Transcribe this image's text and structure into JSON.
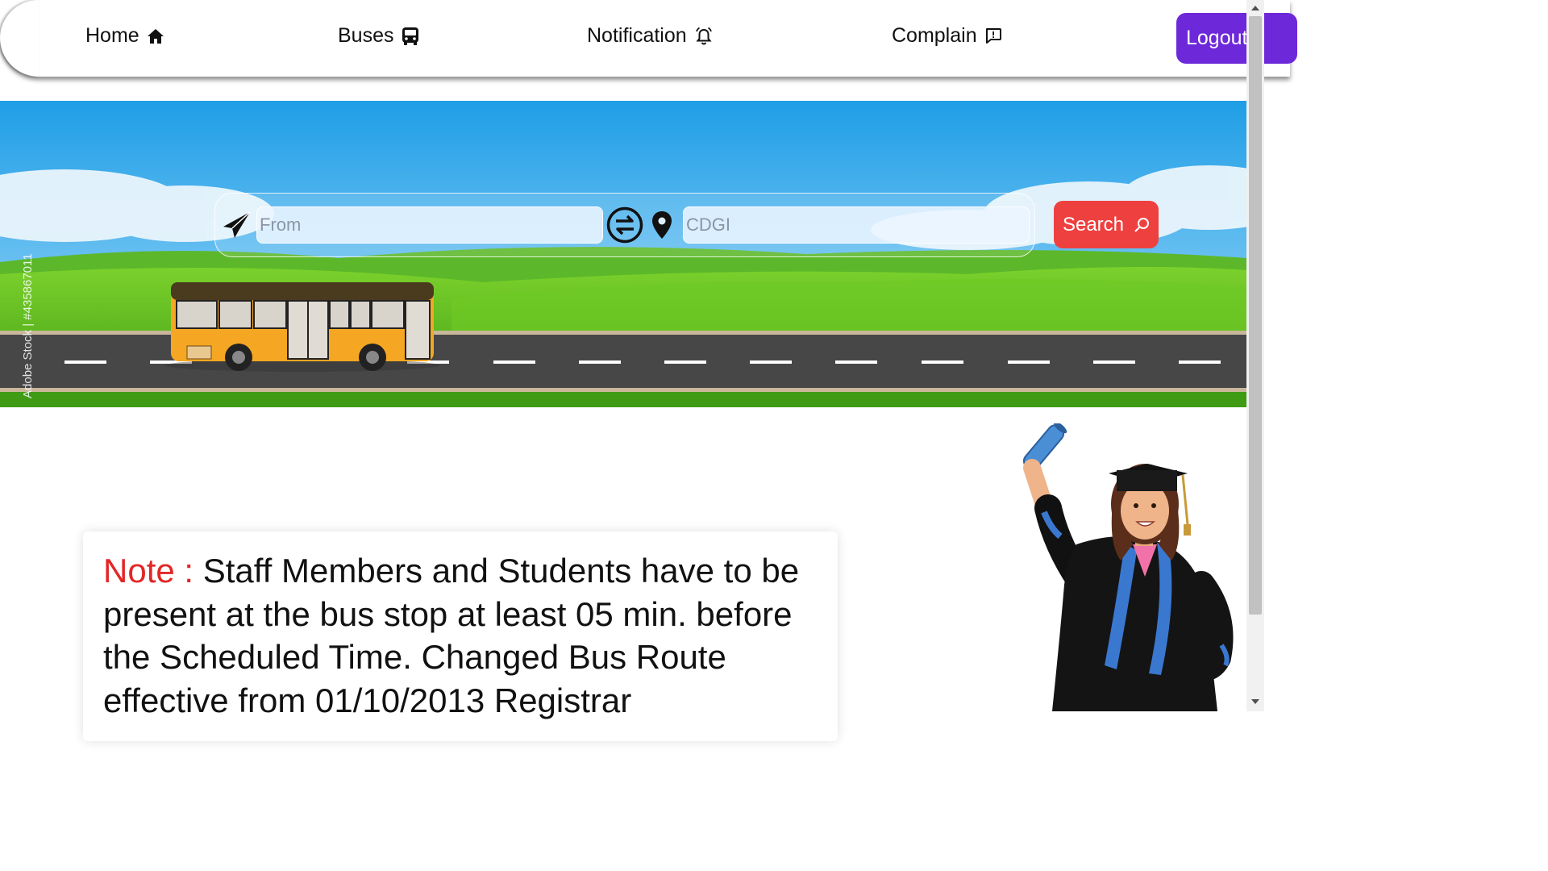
{
  "nav": {
    "items": [
      {
        "label": "Home",
        "icon": "home-icon"
      },
      {
        "label": "Buses",
        "icon": "bus-icon"
      },
      {
        "label": "Notification",
        "icon": "bell-icon"
      },
      {
        "label": "Complain",
        "icon": "chat-alert-icon"
      }
    ],
    "logout_label": "Logout"
  },
  "search": {
    "from_placeholder": "From",
    "from_icon": "paper-plane-icon",
    "swap_icon": "swap-arrows-icon",
    "to_icon": "map-pin-icon",
    "to_value": "CDGI",
    "button_label": "Search",
    "button_icon": "search-icon"
  },
  "hero": {
    "watermark": "Adobe Stock | #435867011"
  },
  "note": {
    "label": "Note :",
    "text": " Staff Members and Students have to be present at the bus stop at least 05 min. before the Scheduled Time. Changed Bus Route effective from 01/10/2013 Registrar"
  },
  "colors": {
    "accent_purple": "#6d28d9",
    "search_red": "#ef4040",
    "note_red": "#e32626",
    "sky_blue": "#1e9fe8",
    "grass_green": "#4caf1a",
    "road_gray": "#474747",
    "bus_orange": "#f5a623"
  }
}
